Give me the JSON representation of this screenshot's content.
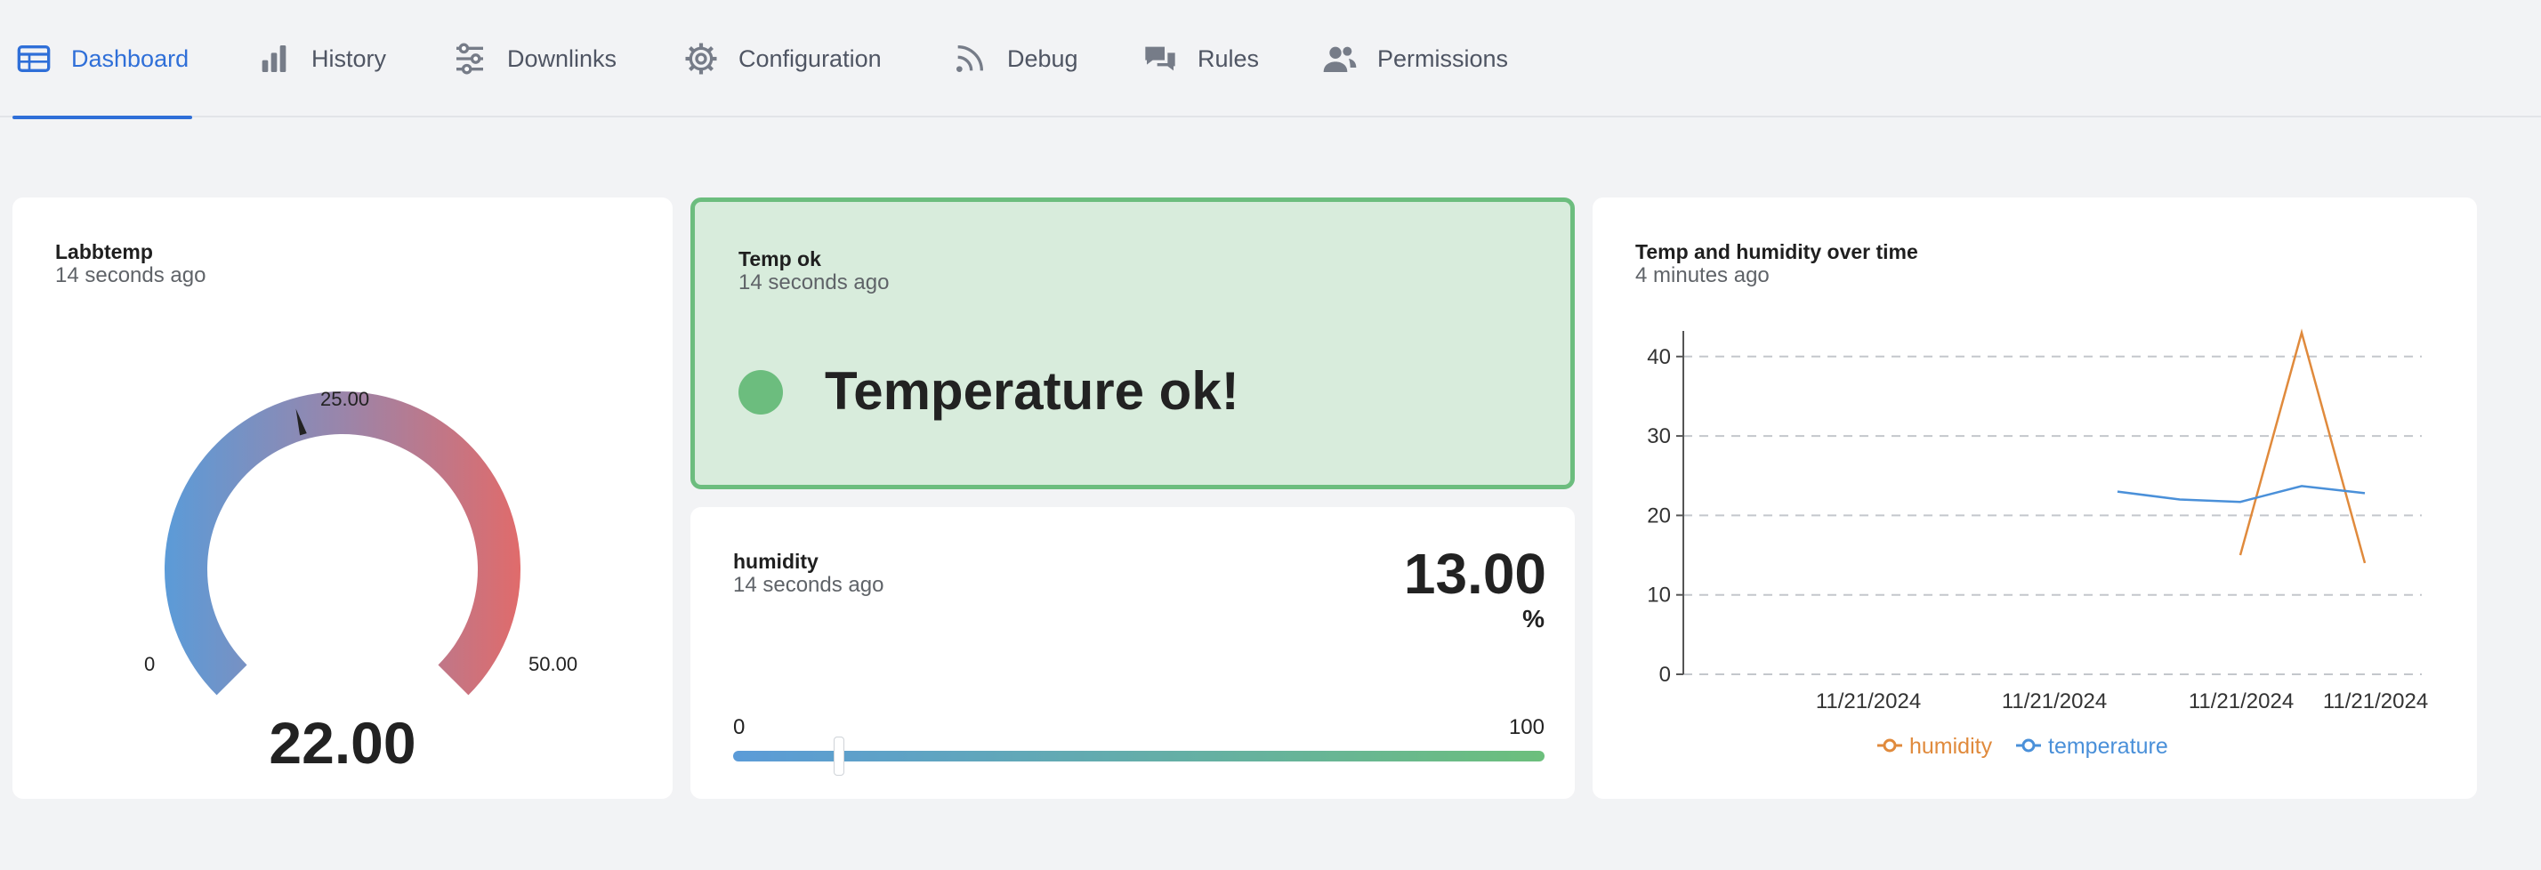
{
  "tabs": [
    {
      "label": "Dashboard",
      "icon": "table-icon",
      "active": true
    },
    {
      "label": "History",
      "icon": "bar-chart-icon",
      "active": false
    },
    {
      "label": "Downlinks",
      "icon": "sliders-icon",
      "active": false
    },
    {
      "label": "Configuration",
      "icon": "gear-icon",
      "active": false
    },
    {
      "label": "Debug",
      "icon": "rss-icon",
      "active": false
    },
    {
      "label": "Rules",
      "icon": "chat-bubbles-icon",
      "active": false
    },
    {
      "label": "Permissions",
      "icon": "users-icon",
      "active": false
    }
  ],
  "gauge": {
    "title": "Labbtemp",
    "timestamp": "14 seconds ago",
    "value_text": "22.00",
    "value": 22,
    "min_label": "0",
    "mid_label": "25.00",
    "max_label": "50.00",
    "min": 0,
    "max": 50,
    "colors": {
      "start": "#5b9bd8",
      "mid": "#9a85aa",
      "end": "#e06b6b"
    }
  },
  "status": {
    "title": "Temp ok",
    "timestamp": "14 seconds ago",
    "message": "Temperature ok!",
    "color": "#6cbd7e",
    "background": "#d8ecdc"
  },
  "humidity": {
    "title": "humidity",
    "timestamp": "14 seconds ago",
    "value_text": "13.00",
    "unit": "%",
    "min_label": "0",
    "max_label": "100",
    "value": 13,
    "min": 0,
    "max": 100
  },
  "chart": {
    "title": "Temp and humidity over time",
    "timestamp": "4 minutes ago"
  },
  "chart_data": {
    "type": "line",
    "title": "Temp and humidity over time",
    "xlabel": "",
    "ylabel": "",
    "ylim": [
      0,
      43
    ],
    "yticks": [
      0,
      10,
      20,
      30,
      40
    ],
    "xtick_labels": [
      "11/21/2024",
      "11/21/2024",
      "11/21/2024",
      "11/21/2024"
    ],
    "grid": true,
    "legend_position": "bottom",
    "series": [
      {
        "name": "humidity",
        "color": "#e08a3c",
        "values": [
          15,
          43,
          14
        ]
      },
      {
        "name": "temperature",
        "color": "#4a90d9",
        "values": [
          23,
          22,
          21.7,
          23.7,
          22.8
        ]
      }
    ]
  }
}
